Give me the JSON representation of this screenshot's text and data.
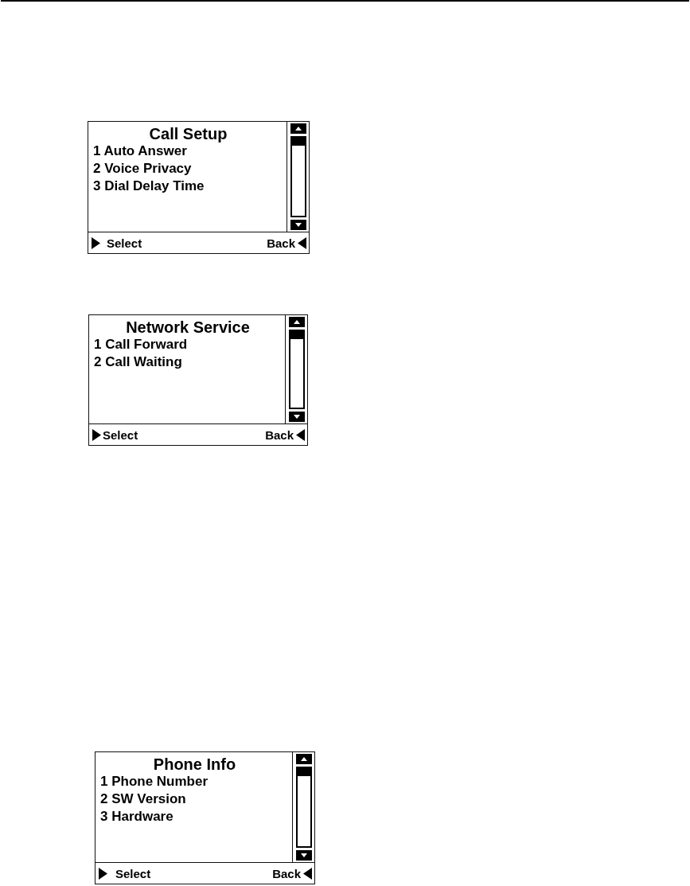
{
  "screens": [
    {
      "title": "Call Setup",
      "items": [
        "1 Auto Answer",
        "2 Voice Privacy",
        "3 Dial Delay Time"
      ],
      "softkeys": {
        "left": "Select",
        "right": "Back"
      }
    },
    {
      "title": "Network Service",
      "items": [
        "1 Call Forward",
        "2 Call Waiting"
      ],
      "softkeys": {
        "left": "Select",
        "right": "Back"
      }
    },
    {
      "title": "Phone Info",
      "items": [
        "1 Phone Number",
        "2 SW Version",
        "3 Hardware"
      ],
      "softkeys": {
        "left": "Select",
        "right": "Back"
      }
    }
  ]
}
